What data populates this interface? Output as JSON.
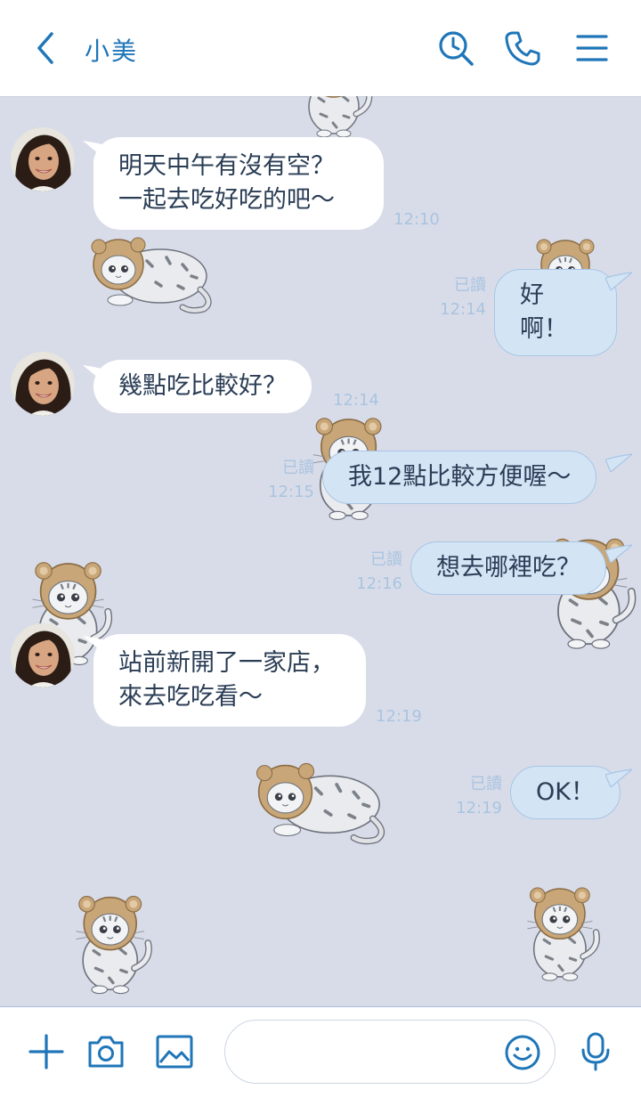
{
  "header": {
    "contact_name": "小美",
    "icons": [
      "back-icon",
      "search-history-icon",
      "phone-icon",
      "menu-icon"
    ]
  },
  "messages": [
    {
      "direction": "in",
      "text": "明天中午有沒有空？\n一起去吃好吃的吧～",
      "time": "12:10"
    },
    {
      "direction": "out",
      "text": "好啊！",
      "read": "已讀",
      "time": "12:14"
    },
    {
      "direction": "in",
      "text": "幾點吃比較好？",
      "time": "12:14"
    },
    {
      "direction": "out",
      "text": "我12點比較方便喔～",
      "read": "已讀",
      "time": "12:15"
    },
    {
      "direction": "out",
      "text": "想去哪裡吃？",
      "read": "已讀",
      "time": "12:16"
    },
    {
      "direction": "in",
      "text": "站前新開了一家店，\n來去吃吃看～",
      "time": "12:19"
    },
    {
      "direction": "out",
      "text": "OK！",
      "read": "已讀",
      "time": "12:19"
    }
  ],
  "footer": {
    "input_value": "",
    "icons": [
      "plus-icon",
      "camera-icon",
      "image-icon",
      "emoji-icon",
      "microphone-icon"
    ]
  },
  "colors": {
    "accent": "#1f76b8",
    "background": "#d8dce9",
    "outgoing_bubble": "#d3e4f5",
    "incoming_bubble": "#ffffff",
    "meta_text": "#a9c4e0"
  }
}
